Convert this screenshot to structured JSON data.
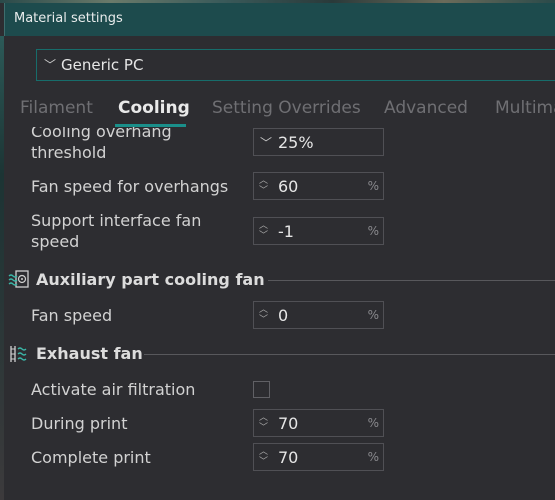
{
  "window": {
    "title": "Material settings"
  },
  "material": {
    "selected": "Generic PC"
  },
  "tabs": [
    {
      "label": "Filament"
    },
    {
      "label": "Cooling"
    },
    {
      "label": "Setting Overrides"
    },
    {
      "label": "Advanced"
    },
    {
      "label": "Multima"
    }
  ],
  "active_tab": "Cooling",
  "cooling": {
    "overhang_threshold": {
      "label_line1": "Cooling overhang",
      "label_line2": "threshold",
      "value": "25%"
    },
    "fan_speed_overhangs": {
      "label": "Fan speed for overhangs",
      "value": "60",
      "unit": "%"
    },
    "support_interface_fan": {
      "label_line1": "Support interface fan",
      "label_line2": "speed",
      "value": "-1",
      "unit": "%"
    }
  },
  "auxiliary": {
    "title": "Auxiliary part cooling fan",
    "fan_speed": {
      "label": "Fan speed",
      "value": "0",
      "unit": "%"
    }
  },
  "exhaust": {
    "title": "Exhaust fan",
    "air_filtration": {
      "label": "Activate air filtration",
      "checked": false
    },
    "during_print": {
      "label": "During print",
      "value": "70",
      "unit": "%"
    },
    "complete_print": {
      "label": "Complete print",
      "value": "70",
      "unit": "%"
    }
  },
  "icons": {
    "combo": "chevron-down-icon",
    "spin_up": "spin-up-icon",
    "spin_down": "spin-down-icon",
    "aux_fan": "auxiliary-fan-icon",
    "exhaust_fan": "exhaust-fan-icon"
  },
  "colors": {
    "titlebar": "#1d4b4d",
    "accent": "#1a8f8a",
    "background": "#2d2d31"
  }
}
